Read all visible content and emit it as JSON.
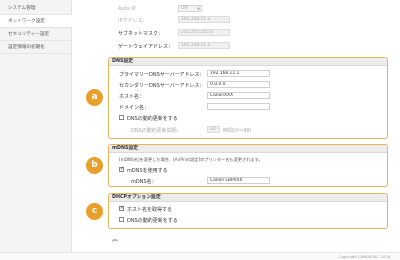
{
  "sidebar": {
    "items": [
      {
        "label": "システム管理"
      },
      {
        "label": "ネットワーク設定"
      },
      {
        "label": "セキュリティー設定"
      },
      {
        "label": "設定情報の初期化"
      }
    ]
  },
  "top": {
    "auto_ip_label": "Auto IP",
    "auto_ip_value": "ON",
    "ip_label": "IPアドレス：",
    "ip_value": "192.168.11.2",
    "subnet_label": "サブネットマスク：",
    "subnet_value": "255.255.255.0",
    "gateway_label": "ゲートウェイアドレス：",
    "gateway_value": "192.168.11.1"
  },
  "dns": {
    "title": "DNS設定",
    "primary_label": "プライマリーDNSサーバーアドレス：",
    "primary_value": "192.168.11.1",
    "secondary_label": "セカンダリーDNSサーバーアドレス：",
    "secondary_value": "0.0.0.0",
    "host_label": "ホスト名：",
    "host_value": "CanonXXX",
    "domain_label": "ドメイン名：",
    "domain_value": "",
    "dynamic_update_label": "DNSの動的更新をする",
    "interval_label": "DNSの動的更新間隔：",
    "interval_value": "24",
    "interval_unit": "時間(0～48)",
    "badge": "a"
  },
  "mdns": {
    "title": "mDNS設定",
    "note": "[mDNS名]を変更した場合、[AirPrint設定]のプリンター名も変更されます。",
    "use_label": "mDNSを使用する",
    "name_label": "mDNS名：",
    "name_value": "Canon LBPXXX",
    "badge": "b"
  },
  "dhcp": {
    "title": "DHCPオプション設定",
    "acquire_label": "ホスト名を取得する",
    "dynamic_label": "DNSの動的更新をする",
    "badge": "c"
  },
  "collapse_icon": "chevron-double-up-icon",
  "footer": "Copyright CANON INC. 2016",
  "colors": {
    "accent": "#e9a02a",
    "section_border": "#e6b45a"
  }
}
